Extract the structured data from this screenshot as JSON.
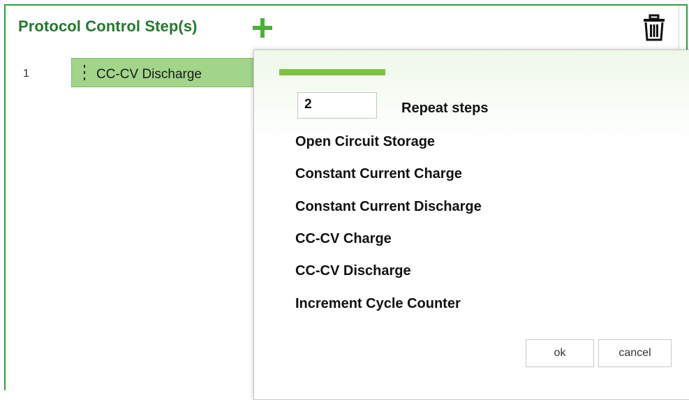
{
  "panel": {
    "title": "Protocol Control Step(s)",
    "accent_color": "#217a2c",
    "add_icon": "plus-icon",
    "delete_icon": "trash-icon"
  },
  "steps": [
    {
      "number": "1",
      "label": "CC-CV Discharge",
      "handle_icon": "drag-handle-icon"
    }
  ],
  "popup": {
    "repeat_value": "2",
    "repeat_label": "Repeat steps",
    "options": [
      "Open Circuit Storage",
      "Constant Current Charge",
      "Constant Current Discharge",
      "CC-CV Charge",
      "CC-CV Discharge",
      "Increment Cycle Counter"
    ],
    "ok_label": "ok",
    "cancel_label": "cancel"
  }
}
